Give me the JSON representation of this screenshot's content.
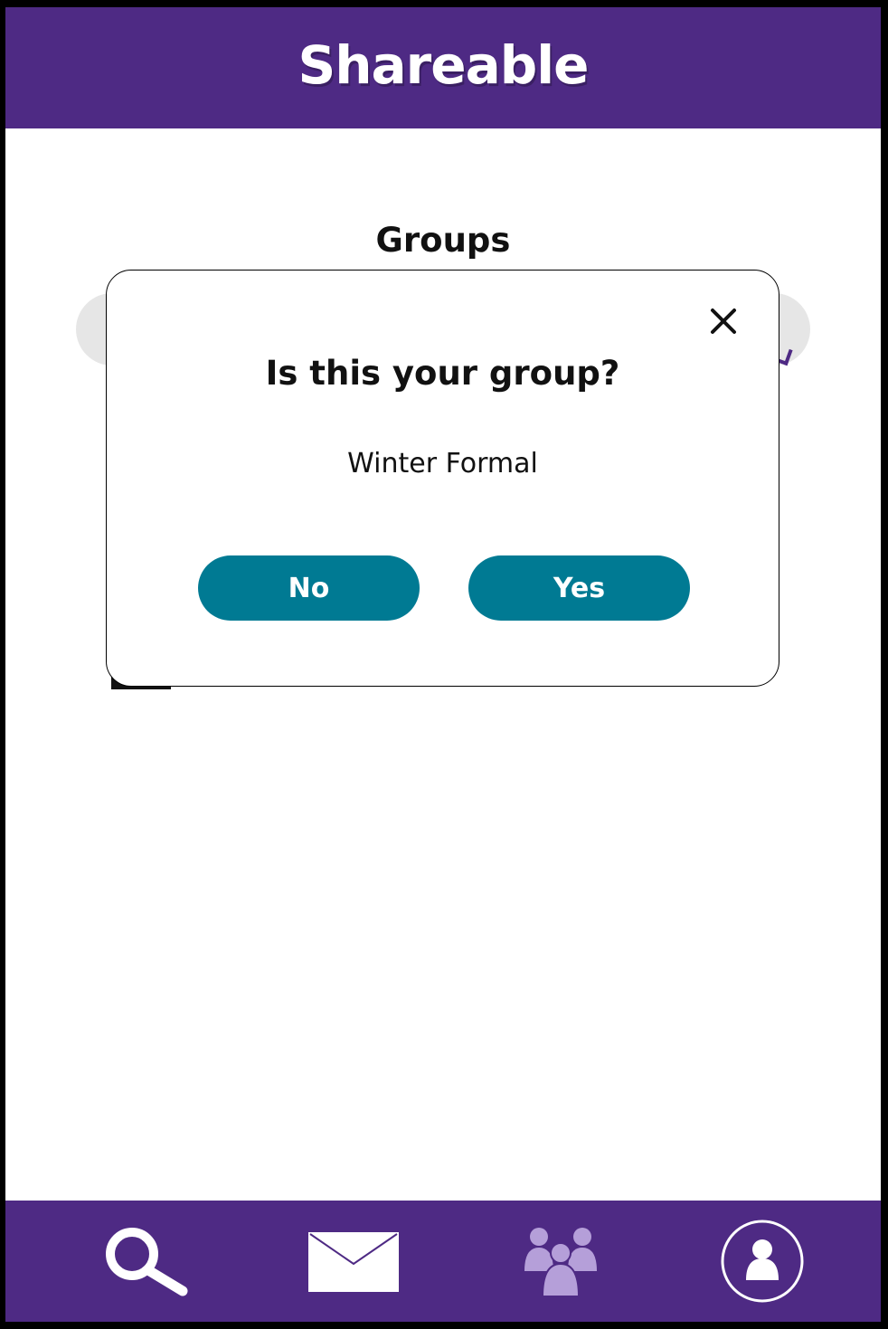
{
  "app": {
    "title": "Shareable"
  },
  "page": {
    "title": "Groups"
  },
  "modal": {
    "title": "Is this your group?",
    "group_name": "Winter Formal",
    "no_label": "No",
    "yes_label": "Yes",
    "close_icon": "close-icon"
  },
  "bottom_nav": {
    "items": [
      {
        "icon": "search-icon"
      },
      {
        "icon": "mail-icon"
      },
      {
        "icon": "groups-icon",
        "active": true
      },
      {
        "icon": "profile-icon"
      }
    ]
  },
  "colors": {
    "brand": "#4e2a84",
    "button": "#007a93",
    "active_icon": "#b59fd9",
    "search_bar": "#e6e6e6"
  }
}
